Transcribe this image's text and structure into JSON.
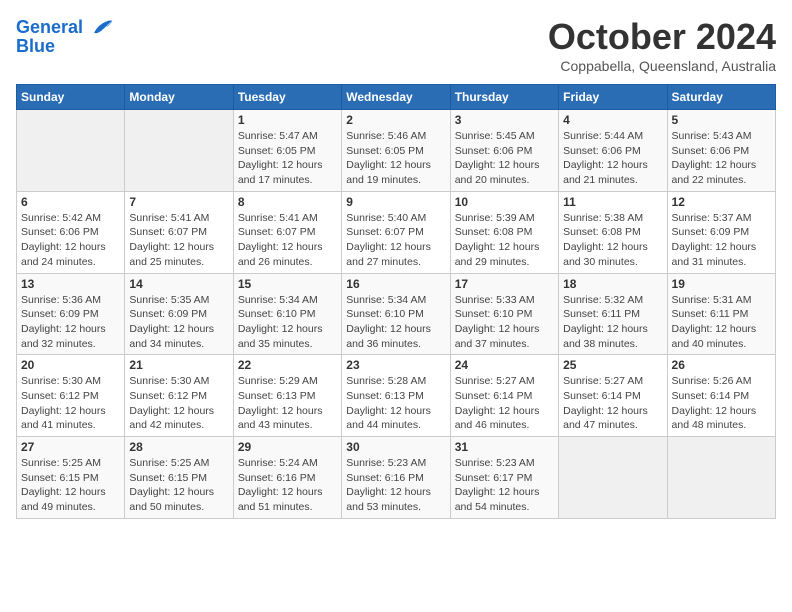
{
  "header": {
    "logo_line1": "General",
    "logo_line2": "Blue",
    "month": "October 2024",
    "location": "Coppabella, Queensland, Australia"
  },
  "weekdays": [
    "Sunday",
    "Monday",
    "Tuesday",
    "Wednesday",
    "Thursday",
    "Friday",
    "Saturday"
  ],
  "weeks": [
    [
      {
        "day": "",
        "info": ""
      },
      {
        "day": "",
        "info": ""
      },
      {
        "day": "1",
        "info": "Sunrise: 5:47 AM\nSunset: 6:05 PM\nDaylight: 12 hours and 17 minutes."
      },
      {
        "day": "2",
        "info": "Sunrise: 5:46 AM\nSunset: 6:05 PM\nDaylight: 12 hours and 19 minutes."
      },
      {
        "day": "3",
        "info": "Sunrise: 5:45 AM\nSunset: 6:06 PM\nDaylight: 12 hours and 20 minutes."
      },
      {
        "day": "4",
        "info": "Sunrise: 5:44 AM\nSunset: 6:06 PM\nDaylight: 12 hours and 21 minutes."
      },
      {
        "day": "5",
        "info": "Sunrise: 5:43 AM\nSunset: 6:06 PM\nDaylight: 12 hours and 22 minutes."
      }
    ],
    [
      {
        "day": "6",
        "info": "Sunrise: 5:42 AM\nSunset: 6:06 PM\nDaylight: 12 hours and 24 minutes."
      },
      {
        "day": "7",
        "info": "Sunrise: 5:41 AM\nSunset: 6:07 PM\nDaylight: 12 hours and 25 minutes."
      },
      {
        "day": "8",
        "info": "Sunrise: 5:41 AM\nSunset: 6:07 PM\nDaylight: 12 hours and 26 minutes."
      },
      {
        "day": "9",
        "info": "Sunrise: 5:40 AM\nSunset: 6:07 PM\nDaylight: 12 hours and 27 minutes."
      },
      {
        "day": "10",
        "info": "Sunrise: 5:39 AM\nSunset: 6:08 PM\nDaylight: 12 hours and 29 minutes."
      },
      {
        "day": "11",
        "info": "Sunrise: 5:38 AM\nSunset: 6:08 PM\nDaylight: 12 hours and 30 minutes."
      },
      {
        "day": "12",
        "info": "Sunrise: 5:37 AM\nSunset: 6:09 PM\nDaylight: 12 hours and 31 minutes."
      }
    ],
    [
      {
        "day": "13",
        "info": "Sunrise: 5:36 AM\nSunset: 6:09 PM\nDaylight: 12 hours and 32 minutes."
      },
      {
        "day": "14",
        "info": "Sunrise: 5:35 AM\nSunset: 6:09 PM\nDaylight: 12 hours and 34 minutes."
      },
      {
        "day": "15",
        "info": "Sunrise: 5:34 AM\nSunset: 6:10 PM\nDaylight: 12 hours and 35 minutes."
      },
      {
        "day": "16",
        "info": "Sunrise: 5:34 AM\nSunset: 6:10 PM\nDaylight: 12 hours and 36 minutes."
      },
      {
        "day": "17",
        "info": "Sunrise: 5:33 AM\nSunset: 6:10 PM\nDaylight: 12 hours and 37 minutes."
      },
      {
        "day": "18",
        "info": "Sunrise: 5:32 AM\nSunset: 6:11 PM\nDaylight: 12 hours and 38 minutes."
      },
      {
        "day": "19",
        "info": "Sunrise: 5:31 AM\nSunset: 6:11 PM\nDaylight: 12 hours and 40 minutes."
      }
    ],
    [
      {
        "day": "20",
        "info": "Sunrise: 5:30 AM\nSunset: 6:12 PM\nDaylight: 12 hours and 41 minutes."
      },
      {
        "day": "21",
        "info": "Sunrise: 5:30 AM\nSunset: 6:12 PM\nDaylight: 12 hours and 42 minutes."
      },
      {
        "day": "22",
        "info": "Sunrise: 5:29 AM\nSunset: 6:13 PM\nDaylight: 12 hours and 43 minutes."
      },
      {
        "day": "23",
        "info": "Sunrise: 5:28 AM\nSunset: 6:13 PM\nDaylight: 12 hours and 44 minutes."
      },
      {
        "day": "24",
        "info": "Sunrise: 5:27 AM\nSunset: 6:14 PM\nDaylight: 12 hours and 46 minutes."
      },
      {
        "day": "25",
        "info": "Sunrise: 5:27 AM\nSunset: 6:14 PM\nDaylight: 12 hours and 47 minutes."
      },
      {
        "day": "26",
        "info": "Sunrise: 5:26 AM\nSunset: 6:14 PM\nDaylight: 12 hours and 48 minutes."
      }
    ],
    [
      {
        "day": "27",
        "info": "Sunrise: 5:25 AM\nSunset: 6:15 PM\nDaylight: 12 hours and 49 minutes."
      },
      {
        "day": "28",
        "info": "Sunrise: 5:25 AM\nSunset: 6:15 PM\nDaylight: 12 hours and 50 minutes."
      },
      {
        "day": "29",
        "info": "Sunrise: 5:24 AM\nSunset: 6:16 PM\nDaylight: 12 hours and 51 minutes."
      },
      {
        "day": "30",
        "info": "Sunrise: 5:23 AM\nSunset: 6:16 PM\nDaylight: 12 hours and 53 minutes."
      },
      {
        "day": "31",
        "info": "Sunrise: 5:23 AM\nSunset: 6:17 PM\nDaylight: 12 hours and 54 minutes."
      },
      {
        "day": "",
        "info": ""
      },
      {
        "day": "",
        "info": ""
      }
    ]
  ]
}
